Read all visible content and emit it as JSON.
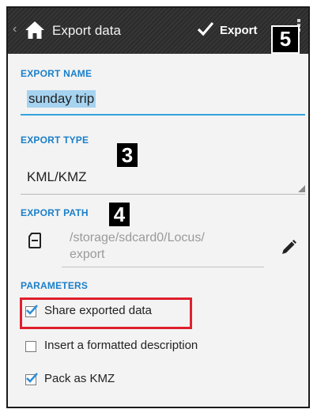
{
  "action_bar": {
    "title": "Export data",
    "export_label": "Export",
    "up_icon": "chevron-left-icon",
    "home_icon": "home-icon",
    "confirm_icon": "check-icon",
    "overflow_icon": "overflow-menu-icon"
  },
  "callouts": {
    "c3": "3",
    "c4": "4",
    "c5": "5"
  },
  "export_name": {
    "label": "EXPORT NAME",
    "value": "sunday trip"
  },
  "export_type": {
    "label": "EXPORT TYPE",
    "value": "KML/KMZ"
  },
  "export_path": {
    "label": "EXPORT PATH",
    "value": "/storage/sdcard0/Locus/\nexport",
    "storage_icon": "sd-card-icon",
    "edit_icon": "pencil-icon"
  },
  "parameters": {
    "label": "PARAMETERS",
    "options": [
      {
        "label": "Share exported data",
        "checked": true
      },
      {
        "label": "Insert a formatted description",
        "checked": false
      },
      {
        "label": "Pack as KMZ",
        "checked": true
      }
    ]
  },
  "colors": {
    "accent": "#1a7fc9",
    "highlight_box": "#e0202d",
    "action_bar": "#2b2b2b"
  }
}
